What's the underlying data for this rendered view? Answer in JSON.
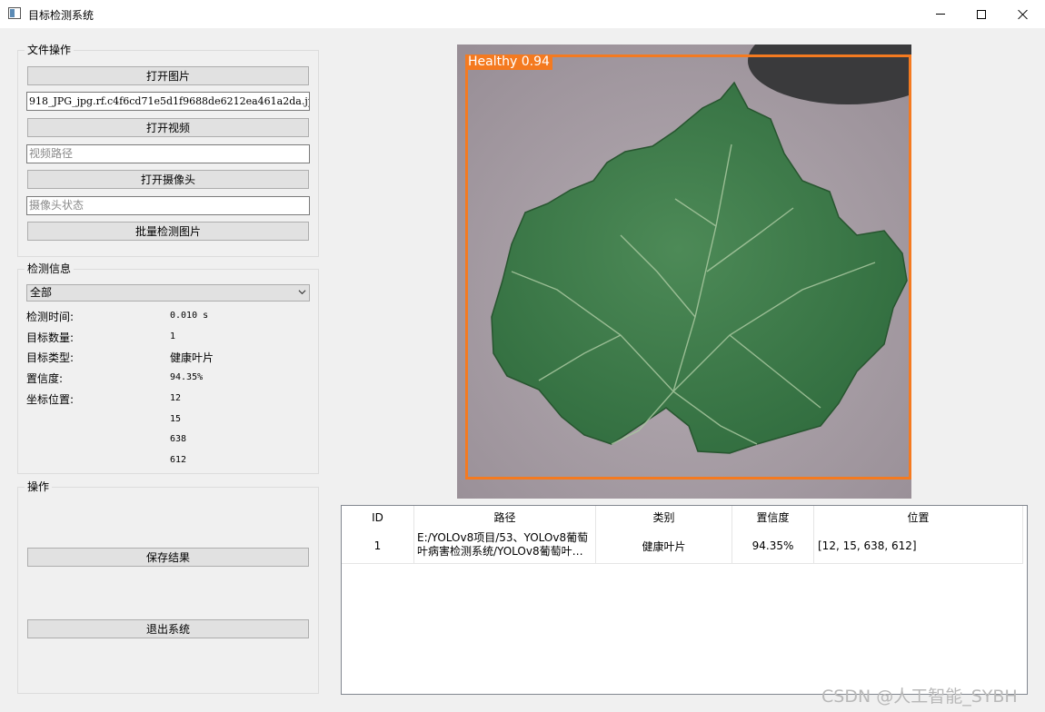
{
  "window": {
    "title": "目标检测系统"
  },
  "file_ops": {
    "title": "文件操作",
    "open_image": "打开图片",
    "image_path": "918_JPG_jpg.rf.c4f6cd71e5d1f9688de6212ea461a2da.jpg",
    "open_video": "打开视频",
    "video_placeholder": "视频路径",
    "open_camera": "打开摄像头",
    "camera_placeholder": "摄像头状态",
    "batch_detect": "批量检测图片"
  },
  "detection_info": {
    "title": "检测信息",
    "filter_selected": "全部",
    "time_label": "检测时间:",
    "time_value": "0.010 s",
    "count_label": "目标数量:",
    "count_value": "1",
    "type_label": "目标类型:",
    "type_value": "健康叶片",
    "conf_label": "置信度:",
    "conf_value": "94.35%",
    "coord_label": "坐标位置:",
    "coords": [
      "12",
      "15",
      "638",
      "612"
    ]
  },
  "operations": {
    "title": "操作",
    "save": "保存结果",
    "exit": "退出系统"
  },
  "preview": {
    "detection_label": "Healthy 0.94",
    "box_color": "#f47a20",
    "leaf_color": "#3e7a49",
    "background_color": "#a99fa6"
  },
  "results_table": {
    "headers": [
      "ID",
      "路径",
      "类别",
      "置信度",
      "位置"
    ],
    "rows": [
      {
        "id": "1",
        "path": "E:/YOLOv8项目/53、YOLOv8葡萄叶病害检测系统/YOLOv8葡萄叶病...",
        "category": "健康叶片",
        "confidence": "94.35%",
        "position": "[12, 15, 638, 612]"
      }
    ]
  },
  "watermark": "CSDN @人工智能_SYBH"
}
